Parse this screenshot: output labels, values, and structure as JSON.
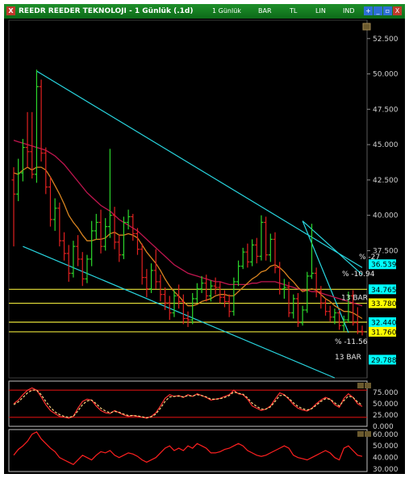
{
  "window": {
    "title": "REEDR REEDER TEKNOLOJI - 1 Günlük (.1d)",
    "toolbar": {
      "period": "1 Günlük",
      "bar": "BAR",
      "tl": "TL",
      "lin": "LIN",
      "ind": "IND"
    },
    "buttons": {
      "close": "X",
      "minimize": "_",
      "plus": "+",
      "restore": "▫"
    }
  },
  "chart_data": [
    {
      "type": "bar",
      "subtype": "ohlc",
      "title": "REEDR REEDER TEKNOLOJI",
      "yticks": [
        "52.500",
        "50.000",
        "47.500",
        "45.000",
        "42.500",
        "40.000",
        "37.500"
      ],
      "ylim": [
        28.5,
        53.8
      ],
      "bars": [
        [
          42.5,
          43.4,
          37.8,
          41.5
        ],
        [
          41.5,
          44.0,
          41.0,
          43.0
        ],
        [
          43.0,
          45.4,
          42.4,
          44.8
        ],
        [
          44.8,
          47.3,
          43.4,
          44.5
        ],
        [
          44.5,
          47.3,
          42.6,
          42.9
        ],
        [
          42.9,
          50.3,
          42.3,
          49.1
        ],
        [
          49.1,
          49.6,
          43.8,
          44.4
        ],
        [
          44.4,
          44.8,
          41.5,
          42.0
        ],
        [
          42.0,
          42.7,
          39.2,
          39.7
        ],
        [
          39.7,
          41.2,
          38.9,
          40.5
        ],
        [
          40.5,
          40.9,
          37.8,
          38.2
        ],
        [
          38.2,
          38.8,
          36.8,
          37.3
        ],
        [
          37.3,
          37.9,
          35.3,
          35.9
        ],
        [
          35.9,
          38.2,
          35.6,
          37.8
        ],
        [
          37.8,
          38.6,
          36.4,
          36.9
        ],
        [
          36.9,
          37.4,
          35.0,
          35.5
        ],
        [
          35.5,
          37.2,
          35.2,
          36.9
        ],
        [
          36.9,
          39.6,
          36.4,
          38.9
        ],
        [
          38.9,
          40.1,
          38.3,
          39.5
        ],
        [
          39.5,
          40.4,
          37.3,
          37.8
        ],
        [
          37.8,
          39.8,
          37.5,
          39.2
        ],
        [
          39.2,
          44.7,
          38.4,
          40.0
        ],
        [
          40.0,
          40.6,
          37.6,
          38.1
        ],
        [
          38.1,
          38.6,
          36.7,
          37.2
        ],
        [
          37.2,
          39.9,
          36.9,
          39.5
        ],
        [
          39.5,
          40.4,
          39.0,
          39.9
        ],
        [
          39.9,
          40.1,
          38.2,
          38.7
        ],
        [
          38.7,
          39.1,
          37.2,
          37.6
        ],
        [
          37.6,
          38.0,
          35.1,
          35.6
        ],
        [
          35.6,
          36.2,
          34.2,
          34.8
        ],
        [
          34.8,
          36.6,
          34.5,
          36.1
        ],
        [
          36.1,
          37.6,
          34.8,
          35.3
        ],
        [
          35.3,
          35.8,
          33.9,
          34.4
        ],
        [
          34.4,
          34.9,
          33.3,
          33.8
        ],
        [
          33.8,
          34.3,
          32.6,
          33.1
        ],
        [
          33.1,
          34.7,
          32.8,
          34.3
        ],
        [
          34.3,
          35.1,
          33.4,
          33.9
        ],
        [
          33.9,
          34.4,
          32.3,
          32.7
        ],
        [
          32.7,
          33.2,
          32.1,
          32.6
        ],
        [
          32.6,
          34.5,
          32.3,
          34.1
        ],
        [
          34.1,
          35.2,
          33.8,
          34.8
        ],
        [
          34.8,
          35.7,
          34.5,
          35.2
        ],
        [
          35.2,
          35.8,
          33.9,
          34.3
        ],
        [
          34.3,
          35.4,
          33.9,
          35.0
        ],
        [
          35.0,
          35.6,
          34.4,
          34.9
        ],
        [
          34.9,
          35.3,
          33.8,
          34.2
        ],
        [
          34.2,
          34.7,
          33.5,
          33.9
        ],
        [
          33.9,
          34.4,
          32.8,
          33.2
        ],
        [
          33.2,
          35.6,
          32.9,
          35.3
        ],
        [
          35.3,
          36.8,
          35.0,
          36.4
        ],
        [
          36.4,
          37.7,
          36.2,
          37.4
        ],
        [
          37.4,
          38.0,
          36.3,
          36.7
        ],
        [
          36.7,
          38.3,
          36.4,
          37.9
        ],
        [
          37.9,
          38.4,
          36.6,
          37.1
        ],
        [
          37.1,
          40.0,
          36.8,
          39.5
        ],
        [
          39.5,
          39.9,
          36.8,
          37.2
        ],
        [
          37.2,
          38.7,
          36.7,
          38.3
        ],
        [
          38.3,
          38.8,
          35.9,
          36.3
        ],
        [
          36.3,
          36.7,
          34.4,
          34.8
        ],
        [
          34.8,
          35.5,
          34.1,
          34.9
        ],
        [
          34.9,
          35.3,
          32.8,
          33.1
        ],
        [
          33.1,
          34.4,
          32.7,
          34.1
        ],
        [
          34.1,
          34.5,
          32.1,
          32.4
        ],
        [
          32.4,
          33.6,
          32.2,
          33.3
        ],
        [
          33.3,
          36.0,
          33.1,
          35.7
        ],
        [
          35.7,
          39.4,
          35.5,
          35.9
        ],
        [
          35.9,
          36.3,
          34.2,
          34.6
        ],
        [
          34.6,
          35.0,
          33.4,
          33.8
        ],
        [
          33.8,
          34.1,
          32.9,
          33.2
        ],
        [
          33.2,
          33.6,
          32.5,
          32.8
        ],
        [
          32.8,
          33.4,
          32.3,
          33.1
        ],
        [
          33.1,
          33.3,
          31.9,
          32.2
        ],
        [
          32.2,
          32.9,
          31.8,
          32.6
        ],
        [
          32.6,
          34.6,
          32.4,
          34.3
        ],
        [
          34.3,
          34.7,
          32.2,
          32.4
        ],
        [
          32.4,
          33.5,
          31.6,
          31.8
        ],
        [
          31.8,
          32.2,
          31.5,
          31.76
        ]
      ],
      "ma_short": [
        43.0,
        42.9,
        43.2,
        43.4,
        43.2,
        43.4,
        43.4,
        43.2,
        42.7,
        42.1,
        41.5,
        40.8,
        40.0,
        39.5,
        39.1,
        38.6,
        38.2,
        38.2,
        38.3,
        38.3,
        38.4,
        38.7,
        38.8,
        38.6,
        38.6,
        38.7,
        38.6,
        38.4,
        37.9,
        37.4,
        37.0,
        36.6,
        36.1,
        35.5,
        35.0,
        34.6,
        34.3,
        33.9,
        33.6,
        33.6,
        33.7,
        33.9,
        34.0,
        34.1,
        34.3,
        34.4,
        34.4,
        34.3,
        34.3,
        34.6,
        34.9,
        35.2,
        35.5,
        35.7,
        36.0,
        36.1,
        36.4,
        36.5,
        36.3,
        36.0,
        35.6,
        35.3,
        34.9,
        34.6,
        34.7,
        34.8,
        34.7,
        34.4,
        34.1,
        33.9,
        33.6,
        33.4,
        33.2,
        33.2,
        33.1,
        32.9,
        32.7
      ],
      "ma_long": [
        45.3,
        45.2,
        45.1,
        45.0,
        44.9,
        44.8,
        44.7,
        44.6,
        44.4,
        44.2,
        43.9,
        43.6,
        43.2,
        42.8,
        42.4,
        42.0,
        41.6,
        41.3,
        41.0,
        40.7,
        40.5,
        40.3,
        40.0,
        39.7,
        39.5,
        39.3,
        39.1,
        38.9,
        38.6,
        38.3,
        38.0,
        37.7,
        37.4,
        37.1,
        36.8,
        36.5,
        36.3,
        36.1,
        35.9,
        35.8,
        35.7,
        35.6,
        35.5,
        35.4,
        35.3,
        35.3,
        35.2,
        35.1,
        35.1,
        35.1,
        35.1,
        35.1,
        35.2,
        35.2,
        35.3,
        35.3,
        35.3,
        35.3,
        35.2,
        35.1,
        35.0,
        34.9,
        34.8,
        34.7,
        34.7,
        34.6,
        34.6,
        34.5,
        34.4,
        34.3,
        34.2,
        34.1,
        34.0,
        33.9,
        33.8,
        33.7,
        33.6
      ],
      "hlines": [
        34.765,
        33.78,
        32.44,
        31.76
      ],
      "price_tags": [
        {
          "text": "36.539",
          "value": 36.539,
          "color": "#00ffff"
        },
        {
          "text": "34.765",
          "value": 34.765,
          "color": "#00ffff"
        },
        {
          "text": "33.780",
          "value": 33.78,
          "color": "#ffff00"
        },
        {
          "text": "32.440",
          "value": 32.44,
          "color": "#00ffff"
        },
        {
          "text": "31.760",
          "value": 31.76,
          "color": "#ffff00"
        },
        {
          "text": "29.788",
          "value": 29.788,
          "color": "#00ffff"
        }
      ],
      "annotations": [
        "% -27",
        "% -10.94",
        "13 BAR",
        "% -11.56",
        "13 BAR"
      ],
      "trendlines": [
        {
          "from": [
            5,
            50.2
          ],
          "to": [
            76,
            36.3
          ]
        },
        {
          "from": [
            2,
            37.8
          ],
          "to": [
            70,
            28.5
          ]
        },
        {
          "from": [
            63,
            39.6
          ],
          "to": [
            76,
            35.8
          ]
        },
        {
          "from": [
            63,
            39.6
          ],
          "to": [
            73,
            31.7
          ]
        }
      ]
    },
    {
      "type": "line",
      "title": "",
      "yticks": [
        "75.000",
        "50.000",
        "25.000",
        "0.000"
      ],
      "ylim": [
        0,
        100
      ],
      "hlines": [
        80,
        20
      ],
      "series": [
        {
          "color": "#ff3030",
          "values": [
            50,
            58,
            70,
            80,
            85,
            80,
            65,
            48,
            35,
            28,
            22,
            20,
            18,
            22,
            40,
            55,
            60,
            58,
            45,
            35,
            30,
            28,
            35,
            30,
            25,
            22,
            24,
            22,
            20,
            18,
            22,
            30,
            45,
            62,
            70,
            66,
            68,
            64,
            70,
            66,
            72,
            68,
            64,
            58,
            60,
            62,
            66,
            70,
            80,
            72,
            70,
            60,
            45,
            40,
            35,
            38,
            45,
            60,
            74,
            70,
            60,
            48,
            40,
            36,
            34,
            40,
            50,
            58,
            64,
            60,
            48,
            42,
            62,
            72,
            64,
            50,
            44
          ]
        },
        {
          "color": "#ffd27f",
          "values": [
            48,
            54,
            64,
            74,
            80,
            80,
            70,
            55,
            42,
            32,
            26,
            22,
            20,
            22,
            34,
            48,
            56,
            58,
            50,
            40,
            34,
            30,
            33,
            31,
            27,
            24,
            24,
            23,
            21,
            19,
            21,
            27,
            40,
            55,
            65,
            66,
            67,
            65,
            68,
            67,
            70,
            68,
            65,
            60,
            60,
            61,
            64,
            68,
            76,
            73,
            71,
            63,
            51,
            44,
            38,
            38,
            43,
            55,
            68,
            69,
            62,
            52,
            44,
            39,
            36,
            39,
            47,
            55,
            61,
            60,
            52,
            45,
            57,
            67,
            64,
            54,
            47
          ]
        }
      ]
    },
    {
      "type": "line",
      "title": "",
      "yticks": [
        "60.000",
        "50.000",
        "40.000",
        "30.000"
      ],
      "ylim": [
        28,
        64
      ],
      "series": [
        {
          "color": "#ff2020",
          "values": [
            42,
            47,
            50,
            54,
            60,
            62,
            56,
            52,
            48,
            45,
            40,
            38,
            36,
            34,
            38,
            42,
            40,
            38,
            42,
            45,
            44,
            46,
            42,
            40,
            42,
            44,
            43,
            41,
            38,
            36,
            38,
            40,
            44,
            48,
            50,
            46,
            48,
            46,
            50,
            48,
            52,
            50,
            48,
            44,
            44,
            45,
            47,
            48,
            50,
            52,
            50,
            46,
            44,
            42,
            41,
            42,
            44,
            46,
            48,
            50,
            48,
            42,
            40,
            39,
            38,
            40,
            42,
            44,
            46,
            44,
            40,
            38,
            48,
            50,
            46,
            42,
            41
          ]
        }
      ]
    }
  ]
}
